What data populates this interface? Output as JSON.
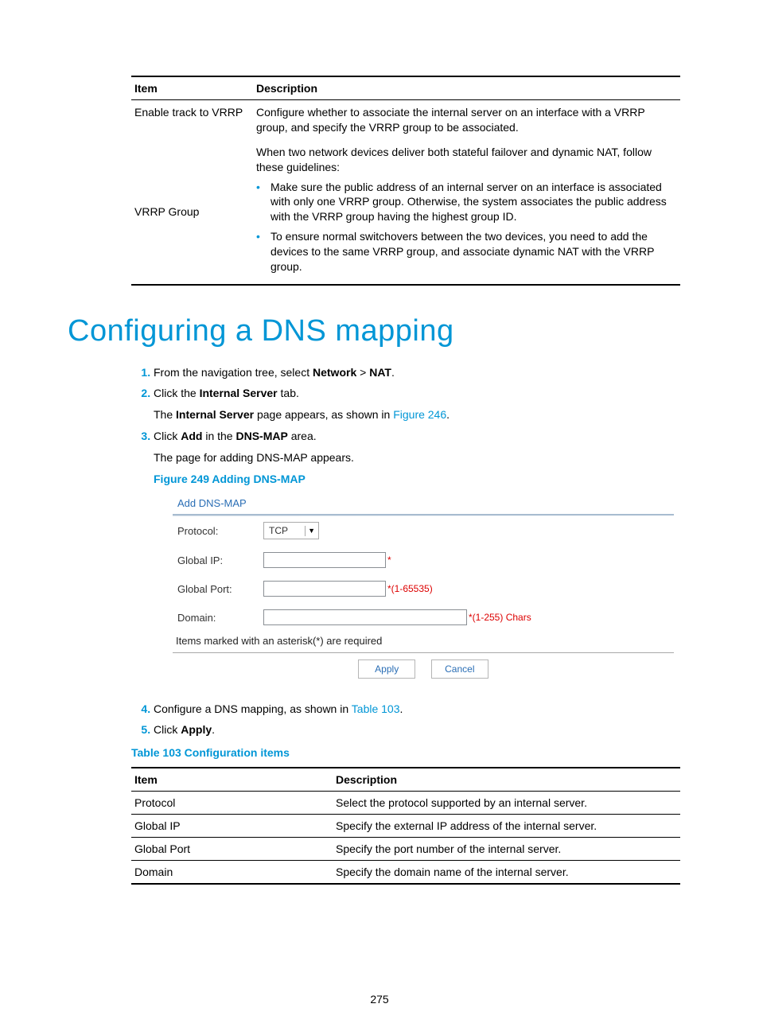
{
  "topTable": {
    "headers": {
      "item": "Item",
      "desc": "Description"
    },
    "rows": [
      {
        "item": "Enable track to VRRP",
        "desc_pre": "Configure whether to associate the internal server on an interface with a VRRP group, and specify the VRRP group to be associated."
      },
      {
        "item": "VRRP Group",
        "desc_pre": "When two network devices deliver both stateful failover and dynamic NAT, follow these guidelines:",
        "bullets": [
          "Make sure the public address of an internal server on an interface is associated with only one VRRP group. Otherwise, the system associates the public address with the VRRP group having the highest group ID.",
          "To ensure normal switchovers between the two devices, you need to add the devices to the same VRRP group, and associate dynamic NAT with the VRRP group."
        ]
      }
    ]
  },
  "heading": "Configuring a DNS mapping",
  "steps": {
    "s1": {
      "pre": "From the navigation tree, select ",
      "b1": "Network",
      "mid": " > ",
      "b2": "NAT",
      "post": "."
    },
    "s2": {
      "line1_pre": "Click the ",
      "line1_b": "Internal Server",
      "line1_post": " tab.",
      "line2_pre": "The ",
      "line2_b": "Internal Server",
      "line2_mid": " page appears, as shown in ",
      "line2_link": "Figure 246",
      "line2_post": "."
    },
    "s3": {
      "line1_pre": "Click ",
      "line1_b1": "Add",
      "line1_mid": " in the ",
      "line1_b2": "DNS-MAP",
      "line1_post": " area.",
      "line2": "The page for adding DNS-MAP appears.",
      "figcap": "Figure 249 Adding DNS-MAP"
    },
    "s4": {
      "pre": "Configure a DNS mapping, as shown in ",
      "link": "Table 103",
      "post": "."
    },
    "s5": {
      "pre": "Click ",
      "b": "Apply",
      "post": "."
    }
  },
  "screenshot": {
    "title": "Add DNS-MAP",
    "rows": {
      "protocol": {
        "label": "Protocol:",
        "value": "TCP"
      },
      "globalIp": {
        "label": "Global IP:",
        "hint": "*"
      },
      "globalPort": {
        "label": "Global Port:",
        "hint": "*(1-65535)"
      },
      "domain": {
        "label": "Domain:",
        "hint": "*(1-255) Chars"
      }
    },
    "note": "Items marked with an asterisk(*) are required",
    "buttons": {
      "apply": "Apply",
      "cancel": "Cancel"
    }
  },
  "table103": {
    "caption": "Table 103 Configuration items",
    "headers": {
      "item": "Item",
      "desc": "Description"
    },
    "rows": [
      {
        "item": "Protocol",
        "desc": "Select the protocol supported by an internal server."
      },
      {
        "item": "Global IP",
        "desc": "Specify the external IP address of the internal server."
      },
      {
        "item": "Global Port",
        "desc": "Specify the port number of the internal server."
      },
      {
        "item": "Domain",
        "desc": "Specify the domain name of the internal server."
      }
    ]
  },
  "pageNumber": "275"
}
